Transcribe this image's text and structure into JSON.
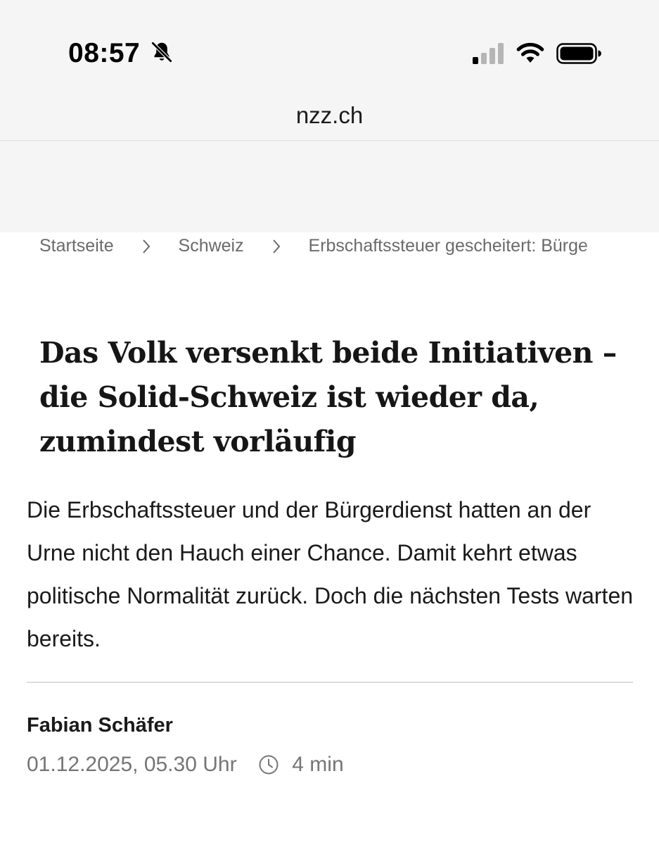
{
  "status_bar": {
    "time": "08:57",
    "icons": [
      "bell-slash-icon",
      "cellular-signal-icon",
      "wifi-icon",
      "battery-icon"
    ]
  },
  "browser": {
    "url": "nzz.ch"
  },
  "breadcrumb": {
    "items": [
      "Startseite",
      "Schweiz",
      "Erbschaftssteuer gescheitert: Bürge"
    ],
    "separator_icon": "chevron-right-icon"
  },
  "article": {
    "headline": "Das Volk versenkt beide Initiativen – die Solid-Schweiz ist wieder da, zumindest vorläufig",
    "lead": "Die Erbschaftssteuer und der Bürgerdienst hatten an der Urne nicht den Hauch einer Chance. Damit kehrt etwas politische Normalität zurück. Doch die nächsten Tests warten bereits.",
    "author": "Fabian Schäfer",
    "date": "01.12.2025, 05.30 Uhr",
    "reading_time": "4 min",
    "reading_time_icon": "clock-icon"
  },
  "colors": {
    "chrome_background": "#f5f5f5",
    "text_primary": "#1a1a1a",
    "text_secondary": "#757575",
    "divider": "#dcdcdc"
  }
}
